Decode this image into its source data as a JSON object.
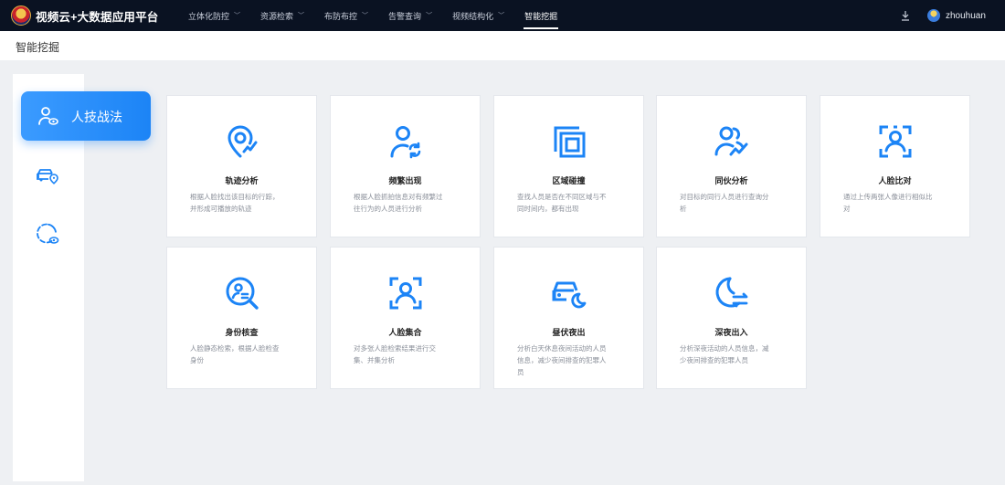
{
  "header": {
    "app_title": "视频云+大数据应用平台",
    "nav": [
      {
        "label": "立体化防控",
        "dropdown": true,
        "active": false
      },
      {
        "label": "资源检索",
        "dropdown": true,
        "active": false
      },
      {
        "label": "布防布控",
        "dropdown": true,
        "active": false
      },
      {
        "label": "告警查询",
        "dropdown": true,
        "active": false
      },
      {
        "label": "视频结构化",
        "dropdown": true,
        "active": false
      },
      {
        "label": "智能挖掘",
        "dropdown": false,
        "active": true
      }
    ],
    "download_icon": "download-icon",
    "username": "zhouhuan"
  },
  "page": {
    "breadcrumb": "智能挖掘"
  },
  "sidebar": {
    "items": [
      {
        "label": "人技战法",
        "icon": "person-eye-icon",
        "active": true
      },
      {
        "icon": "vehicle-location-icon",
        "active": false
      },
      {
        "icon": "circle-eye-icon",
        "active": false
      }
    ]
  },
  "colors": {
    "accent": "#1c84f6",
    "topbar": "#0a1222",
    "background": "#eef0f3"
  },
  "cards": [
    {
      "title": "轨迹分析",
      "desc_lines": [
        "根据人脸找出该目标的行踪，",
        "并形成可播放的轨迹"
      ],
      "icon": "location-track-icon"
    },
    {
      "title": "频繁出现",
      "desc_lines": [
        "根据人脸抓拍信息对有频繁过",
        "往行为的人员进行分析"
      ],
      "icon": "person-refresh-icon"
    },
    {
      "title": "区域碰撞",
      "desc_lines": [
        "查找人员是否在不同区域与不",
        "同时间内，都有出现"
      ],
      "icon": "overlap-squares-icon"
    },
    {
      "title": "同伙分析",
      "desc_lines": [
        "对目标的同行人员进行查询分",
        "析"
      ],
      "icon": "group-trend-icon"
    },
    {
      "title": "人脸比对",
      "desc_lines": [
        "通过上传两张人像进行相似比",
        "对"
      ],
      "icon": "face-frame-icon"
    },
    {
      "title": "身份核查",
      "desc_lines": [
        "人脸静态检索，根据人脸检查",
        "身份"
      ],
      "icon": "id-search-icon"
    },
    {
      "title": "人脸集合",
      "desc_lines": [
        "对多张人脸检索结果进行交",
        "集、并集分析"
      ],
      "icon": "face-scan-icon"
    },
    {
      "title": "昼伏夜出",
      "desc_lines": [
        "分析白天休息夜间活动的人员",
        "信息，减少夜间排查的犯罪人",
        "员"
      ],
      "icon": "car-moon-icon"
    },
    {
      "title": "深夜出入",
      "desc_lines": [
        "分析深夜活动的人员信息，减",
        "少夜间排查的犯罪人员"
      ],
      "icon": "moon-arrows-icon"
    }
  ]
}
